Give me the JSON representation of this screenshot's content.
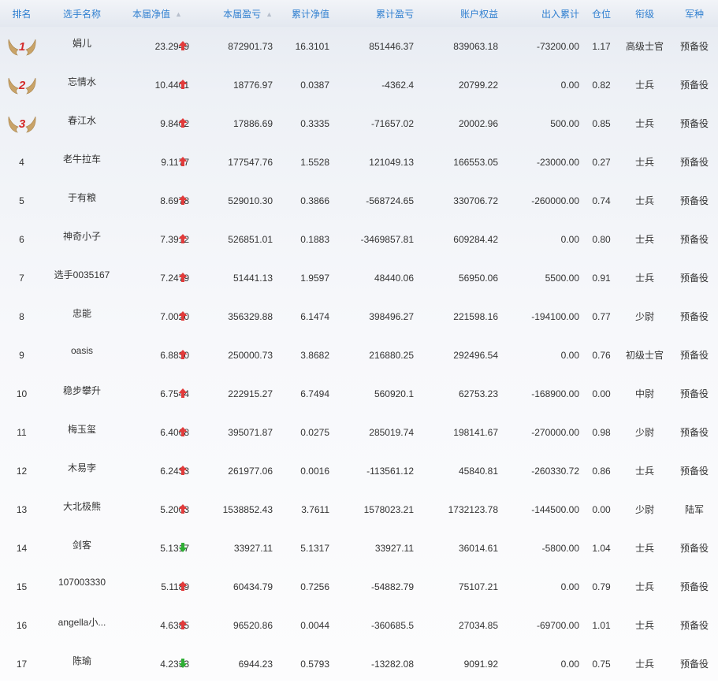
{
  "header": {
    "rank": "排名",
    "name": "选手名称",
    "current_nav": "本届净值",
    "current_pnl": "本届盈亏",
    "total_nav": "累计净值",
    "total_pnl": "累计盈亏",
    "equity": "账户权益",
    "flow": "出入累计",
    "position": "仓位",
    "title": "衔级",
    "service": "军种"
  },
  "colors": {
    "header_text": "#2f7fd0",
    "up_arrow": "#e23b3b",
    "down_arrow": "#2fae35",
    "medal_wing": "#c9a368",
    "medal_number": "#d42a2a"
  },
  "icons": {
    "medal": "winged-medal-icon",
    "up": "arrow-up-icon",
    "down": "arrow-down-icon",
    "sort": "sort-icon"
  },
  "rows": [
    {
      "rank": "1",
      "medal": true,
      "name": "娟儿",
      "current_nav": "23.2949",
      "trend": "up",
      "current_pnl": "872901.73",
      "total_nav": "16.3101",
      "total_pnl": "851446.37",
      "equity": "839063.18",
      "flow": "-73200.00",
      "position": "1.17",
      "title": "高级士官",
      "service": "预备役"
    },
    {
      "rank": "2",
      "medal": true,
      "name": "忘情水",
      "current_nav": "10.4401",
      "trend": "up",
      "current_pnl": "18776.97",
      "total_nav": "0.0387",
      "total_pnl": "-4362.4",
      "equity": "20799.22",
      "flow": "0.00",
      "position": "0.82",
      "title": "士兵",
      "service": "预备役"
    },
    {
      "rank": "3",
      "medal": true,
      "name": "春江水",
      "current_nav": "9.8402",
      "trend": "up",
      "current_pnl": "17886.69",
      "total_nav": "0.3335",
      "total_pnl": "-71657.02",
      "equity": "20002.96",
      "flow": "500.00",
      "position": "0.85",
      "title": "士兵",
      "service": "预备役"
    },
    {
      "rank": "4",
      "medal": false,
      "name": "老牛拉车",
      "current_nav": "9.1177",
      "trend": "up",
      "current_pnl": "177547.76",
      "total_nav": "1.5528",
      "total_pnl": "121049.13",
      "equity": "166553.05",
      "flow": "-23000.00",
      "position": "0.27",
      "title": "士兵",
      "service": "预备役"
    },
    {
      "rank": "5",
      "medal": false,
      "name": "于有粮",
      "current_nav": "8.6978",
      "trend": "up",
      "current_pnl": "529010.30",
      "total_nav": "0.3866",
      "total_pnl": "-568724.65",
      "equity": "330706.72",
      "flow": "-260000.00",
      "position": "0.74",
      "title": "士兵",
      "service": "预备役"
    },
    {
      "rank": "6",
      "medal": false,
      "name": "神奇小子",
      "current_nav": "7.3912",
      "trend": "up",
      "current_pnl": "526851.01",
      "total_nav": "0.1883",
      "total_pnl": "-3469857.81",
      "equity": "609284.42",
      "flow": "0.00",
      "position": "0.80",
      "title": "士兵",
      "service": "预备役"
    },
    {
      "rank": "7",
      "medal": false,
      "name": "选手0035167",
      "current_nav": "7.2479",
      "trend": "up",
      "current_pnl": "51441.13",
      "total_nav": "1.9597",
      "total_pnl": "48440.06",
      "equity": "56950.06",
      "flow": "5500.00",
      "position": "0.91",
      "title": "士兵",
      "service": "预备役"
    },
    {
      "rank": "8",
      "medal": false,
      "name": "忠能",
      "current_nav": "7.0020",
      "trend": "up",
      "current_pnl": "356329.88",
      "total_nav": "6.1474",
      "total_pnl": "398496.27",
      "equity": "221598.16",
      "flow": "-194100.00",
      "position": "0.77",
      "title": "少尉",
      "service": "预备役"
    },
    {
      "rank": "9",
      "medal": false,
      "name": "oasis",
      "current_nav": "6.8830",
      "trend": "up",
      "current_pnl": "250000.73",
      "total_nav": "3.8682",
      "total_pnl": "216880.25",
      "equity": "292496.54",
      "flow": "0.00",
      "position": "0.76",
      "title": "初级士官",
      "service": "预备役"
    },
    {
      "rank": "10",
      "medal": false,
      "name": "稳步攀升",
      "current_nav": "6.7544",
      "trend": "up",
      "current_pnl": "222915.27",
      "total_nav": "6.7494",
      "total_pnl": "560920.1",
      "equity": "62753.23",
      "flow": "-168900.00",
      "position": "0.00",
      "title": "中尉",
      "service": "预备役"
    },
    {
      "rank": "11",
      "medal": false,
      "name": "梅玉玺",
      "current_nav": "6.4068",
      "trend": "up",
      "current_pnl": "395071.87",
      "total_nav": "0.0275",
      "total_pnl": "285019.74",
      "equity": "198141.67",
      "flow": "-270000.00",
      "position": "0.98",
      "title": "少尉",
      "service": "预备役"
    },
    {
      "rank": "12",
      "medal": false,
      "name": "木易孛",
      "current_nav": "6.2433",
      "trend": "up",
      "current_pnl": "261977.06",
      "total_nav": "0.0016",
      "total_pnl": "-113561.12",
      "equity": "45840.81",
      "flow": "-260330.72",
      "position": "0.86",
      "title": "士兵",
      "service": "预备役"
    },
    {
      "rank": "13",
      "medal": false,
      "name": "大北极熊",
      "current_nav": "5.2003",
      "trend": "up",
      "current_pnl": "1538852.43",
      "total_nav": "3.7611",
      "total_pnl": "1578023.21",
      "equity": "1732123.78",
      "flow": "-144500.00",
      "position": "0.00",
      "title": "少尉",
      "service": "陆军"
    },
    {
      "rank": "14",
      "medal": false,
      "name": "剑客",
      "current_nav": "5.1317",
      "trend": "down",
      "current_pnl": "33927.11",
      "total_nav": "5.1317",
      "total_pnl": "33927.11",
      "equity": "36014.61",
      "flow": "-5800.00",
      "position": "1.04",
      "title": "士兵",
      "service": "预备役"
    },
    {
      "rank": "15",
      "medal": false,
      "name": "107003330",
      "current_nav": "5.1189",
      "trend": "up",
      "current_pnl": "60434.79",
      "total_nav": "0.7256",
      "total_pnl": "-54882.79",
      "equity": "75107.21",
      "flow": "0.00",
      "position": "0.79",
      "title": "士兵",
      "service": "预备役"
    },
    {
      "rank": "16",
      "medal": false,
      "name": "angella小...",
      "current_nav": "4.6385",
      "trend": "up",
      "current_pnl": "96520.86",
      "total_nav": "0.0044",
      "total_pnl": "-360685.5",
      "equity": "27034.85",
      "flow": "-69700.00",
      "position": "1.01",
      "title": "士兵",
      "service": "预备役"
    },
    {
      "rank": "17",
      "medal": false,
      "name": "陈瑜",
      "current_nav": "4.2333",
      "trend": "down",
      "current_pnl": "6944.23",
      "total_nav": "0.5793",
      "total_pnl": "-13282.08",
      "equity": "9091.92",
      "flow": "0.00",
      "position": "0.75",
      "title": "士兵",
      "service": "预备役"
    }
  ]
}
